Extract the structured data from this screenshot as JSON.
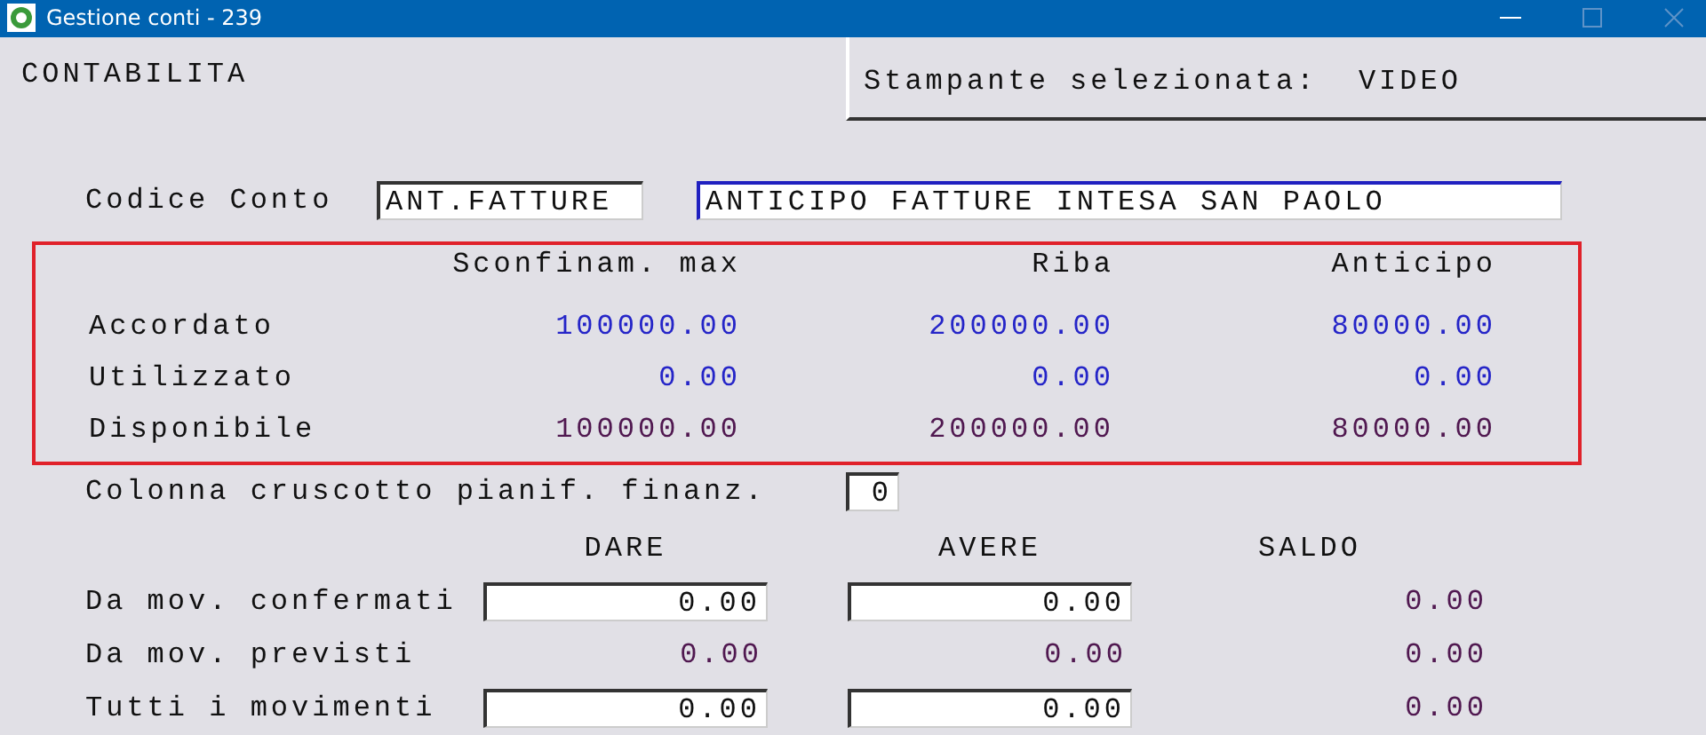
{
  "window": {
    "title": "Gestione conti - 239"
  },
  "module": "CONTABILITA",
  "printer": "Stampante selezionata:  VIDEO",
  "account": {
    "label": "Codice Conto",
    "code": "ANT.FATTURE",
    "description": "ANTICIPO FATTURE INTESA SAN PAOLO"
  },
  "limits": {
    "columns": [
      "Sconfinam. max",
      "Riba",
      "Anticipo"
    ],
    "rows": [
      {
        "label": "Accordato",
        "kind": "set",
        "values": [
          "100000.00",
          "200000.00",
          "80000.00"
        ]
      },
      {
        "label": "Utilizzato",
        "kind": "set",
        "values": [
          "0.00",
          "0.00",
          "0.00"
        ]
      },
      {
        "label": "Disponibile",
        "kind": "computed",
        "values": [
          "100000.00",
          "200000.00",
          "80000.00"
        ]
      }
    ]
  },
  "dashboard_column": {
    "label": "Colonna cruscotto pianif. finanz.",
    "value": "0"
  },
  "movements": {
    "columns": [
      "DARE",
      "AVERE",
      "SALDO"
    ],
    "rows": [
      {
        "label": "Da mov. confermati",
        "cells": [
          {
            "kind": "field",
            "value": "0.00"
          },
          {
            "kind": "field",
            "value": "0.00"
          },
          {
            "kind": "text",
            "value": "0.00"
          }
        ]
      },
      {
        "label": "Da mov. previsti",
        "cells": [
          {
            "kind": "text",
            "value": "0.00"
          },
          {
            "kind": "text",
            "value": "0.00"
          },
          {
            "kind": "text",
            "value": "0.00"
          }
        ]
      },
      {
        "label": "Tutti i movimenti",
        "cells": [
          {
            "kind": "field",
            "value": "0.00"
          },
          {
            "kind": "field",
            "value": "0.00"
          },
          {
            "kind": "text",
            "value": "0.00"
          }
        ]
      }
    ]
  }
}
